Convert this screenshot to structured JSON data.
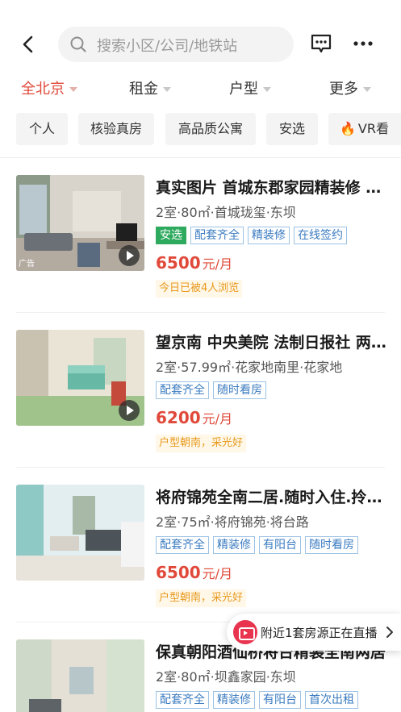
{
  "search": {
    "placeholder": "搜索小区/公司/地铁站"
  },
  "filters": [
    {
      "label": "全北京",
      "active": true
    },
    {
      "label": "租金",
      "active": false
    },
    {
      "label": "户型",
      "active": false
    },
    {
      "label": "更多",
      "active": false
    }
  ],
  "chips": [
    "个人",
    "核验真房",
    "高品质公寓",
    "安选",
    "VR看"
  ],
  "listings": [
    {
      "title": "真实图片 首城东郡家园精装修 两居室 配套齐全",
      "meta": "2室·80㎡·首城珑玺·东坝",
      "tags": [
        {
          "label": "安选",
          "style": "green"
        },
        {
          "label": "配套齐全",
          "style": "outline"
        },
        {
          "label": "精装修",
          "style": "outline"
        },
        {
          "label": "在线签约",
          "style": "outline"
        }
      ],
      "price": "6500",
      "price_unit": "元/月",
      "note": "今日已被4人浏览",
      "ad_label": "广告"
    },
    {
      "title": "望京南 中央美院 法制日报社 两居室",
      "meta": "2室·57.99㎡·花家地南里·花家地",
      "tags": [
        {
          "label": "配套齐全",
          "style": "outline"
        },
        {
          "label": "随时看房",
          "style": "outline"
        }
      ],
      "price": "6200",
      "price_unit": "元/月",
      "note": "户型朝南，采光好"
    },
    {
      "title": "将府锦苑全南二居.随时入住.拎包入住",
      "meta": "2室·75㎡·将府锦苑·将台路",
      "tags": [
        {
          "label": "配套齐全",
          "style": "outline"
        },
        {
          "label": "精装修",
          "style": "outline"
        },
        {
          "label": "有阳台",
          "style": "outline"
        },
        {
          "label": "随时看房",
          "style": "outline"
        }
      ],
      "price": "6500",
      "price_unit": "元/月",
      "note": "户型朝南，采光好"
    },
    {
      "title": "保真朝阳酒仙桥将台精装全南两居",
      "meta": "2室·80㎡·坝鑫家园·东坝",
      "tags": [
        {
          "label": "配套齐全",
          "style": "outline"
        },
        {
          "label": "精装修",
          "style": "outline"
        },
        {
          "label": "有阳台",
          "style": "outline"
        },
        {
          "label": "首次出租",
          "style": "outline"
        }
      ]
    }
  ],
  "live_banner": {
    "text": "附近1套房源正在直播"
  },
  "colors": {
    "accent": "#e0493a",
    "tag_blue": "#3a7bc0",
    "tag_green": "#2eaa5e",
    "note_orange": "#e89a1f"
  }
}
